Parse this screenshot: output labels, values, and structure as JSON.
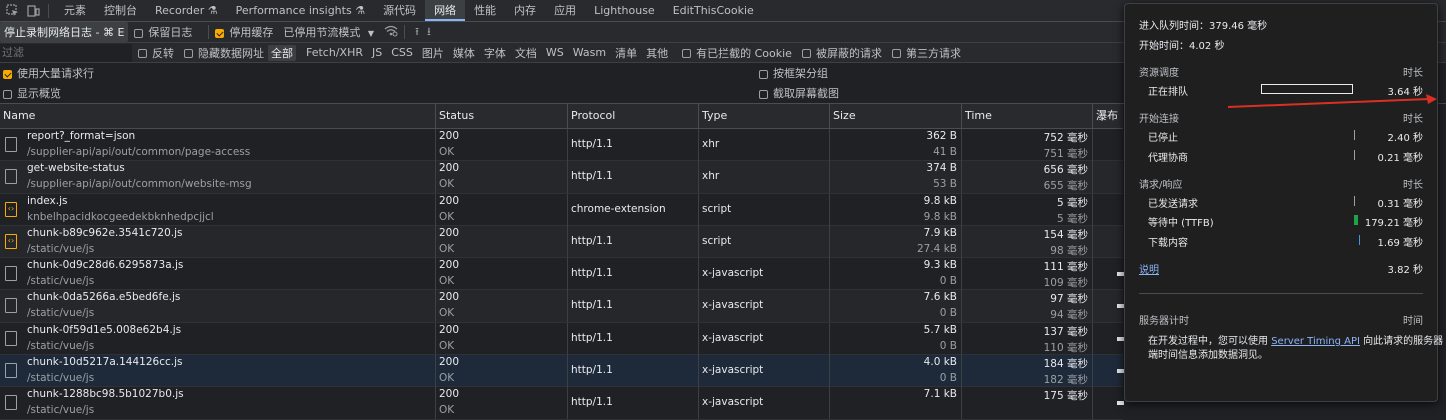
{
  "tabs": [
    "元素",
    "控制台",
    "Recorder",
    "Performance insights",
    "源代码",
    "网络",
    "性能",
    "内存",
    "应用",
    "Lighthouse",
    "EditThisCookie"
  ],
  "toolbar": {
    "stop_tooltip": "停止录制网络日志 - ⌘ E",
    "preserve_log": "保留日志",
    "disable_cache": "停用缓存",
    "throttle": "已停用节流模式"
  },
  "filter_bar": {
    "placeholder": "过滤",
    "invert": "反转",
    "hide_data_urls": "隐藏数据网址",
    "types": [
      "全部",
      "Fetch/XHR",
      "JS",
      "CSS",
      "图片",
      "媒体",
      "字体",
      "文档",
      "WS",
      "Wasm",
      "清单",
      "其他"
    ],
    "blocked_cookies": "有已拦截的 Cookie",
    "blocked_requests": "被屏蔽的请求",
    "third_party": "第三方请求"
  },
  "options": {
    "large_rows": "使用大量请求行",
    "group_by_frame": "按框架分组",
    "show_overview": "显示概览",
    "capture_screenshots": "截取屏幕截图"
  },
  "columns": [
    "Name",
    "Status",
    "Protocol",
    "Type",
    "Size",
    "Time",
    "瀑布"
  ],
  "rows": [
    {
      "name": "report?_format=json",
      "path": "/supplier-api/api/out/common/page-access",
      "status": "200",
      "status_text": "OK",
      "protocol": "http/1.1",
      "type": "xhr",
      "size": "362 B",
      "resource": "41 B",
      "time": "752 毫秒",
      "latency": "751 毫秒",
      "icon": "document-icon"
    },
    {
      "name": "get-website-status",
      "path": "/supplier-api/api/out/common/website-msg",
      "status": "200",
      "status_text": "OK",
      "protocol": "http/1.1",
      "type": "xhr",
      "size": "374 B",
      "resource": "53 B",
      "time": "656 毫秒",
      "latency": "655 毫秒",
      "icon": "document-icon"
    },
    {
      "name": "index.js",
      "path": "knbelhpacidkocgeedekbknhedpcjjcl",
      "status": "200",
      "status_text": "OK",
      "protocol": "chrome-extension",
      "type": "script",
      "size": "9.8 kB",
      "resource": "9.8 kB",
      "time": "5 毫秒",
      "latency": "5 毫秒",
      "icon": "script-icon"
    },
    {
      "name": "chunk-b89c962e.3541c720.js",
      "path": "/static/vue/js",
      "status": "200",
      "status_text": "OK",
      "protocol": "http/1.1",
      "type": "script",
      "size": "7.9 kB",
      "resource": "27.4 kB",
      "time": "154 毫秒",
      "latency": "98 毫秒",
      "icon": "script-icon"
    },
    {
      "name": "chunk-0d9c28d6.6295873a.js",
      "path": "/static/vue/js",
      "status": "200",
      "status_text": "OK",
      "protocol": "http/1.1",
      "type": "x-javascript",
      "size": "9.3 kB",
      "resource": "0 B",
      "time": "111 毫秒",
      "latency": "109 毫秒",
      "icon": "document-icon"
    },
    {
      "name": "chunk-0da5266a.e5bed6fe.js",
      "path": "/static/vue/js",
      "status": "200",
      "status_text": "OK",
      "protocol": "http/1.1",
      "type": "x-javascript",
      "size": "7.6 kB",
      "resource": "0 B",
      "time": "97 毫秒",
      "latency": "94 毫秒",
      "icon": "document-icon"
    },
    {
      "name": "chunk-0f59d1e5.008e62b4.js",
      "path": "/static/vue/js",
      "status": "200",
      "status_text": "OK",
      "protocol": "http/1.1",
      "type": "x-javascript",
      "size": "5.7 kB",
      "resource": "0 B",
      "time": "137 毫秒",
      "latency": "110 毫秒",
      "icon": "document-icon"
    },
    {
      "name": "chunk-10d5217a.144126cc.js",
      "path": "/static/vue/js",
      "status": "200",
      "status_text": "OK",
      "protocol": "http/1.1",
      "type": "x-javascript",
      "size": "4.0 kB",
      "resource": "0 B",
      "time": "184 毫秒",
      "latency": "182 毫秒",
      "icon": "document-icon"
    },
    {
      "name": "chunk-1288bc98.5b1027b0.js",
      "path": "/static/vue/js",
      "status": "200",
      "status_text": "OK",
      "protocol": "http/1.1",
      "type": "x-javascript",
      "size": "7.1 kB",
      "resource": "",
      "time": "175 毫秒",
      "latency": "",
      "icon": "document-icon"
    }
  ],
  "timing": {
    "queued_at": "进入队列时间：379.46 毫秒",
    "started_at": "开始时间：4.02 秒",
    "scheduling_header": "资源调度",
    "duration_label": "时长",
    "queueing_label": "正在排队",
    "queueing_value": "3.64 秒",
    "connection_header": "开始连接",
    "stalled_label": "已停止",
    "stalled_value": "2.40 秒",
    "proxy_label": "代理协商",
    "proxy_value": "0.21 毫秒",
    "request_header": "请求/响应",
    "sent_label": "已发送请求",
    "sent_value": "0.31 毫秒",
    "ttfb_label": "等待中 (TTFB)",
    "ttfb_value": "179.21 毫秒",
    "download_label": "下载内容",
    "download_value": "1.69 毫秒",
    "explanation_link": "说明",
    "total_value": "3.82 秒",
    "server_timing_header": "服务器计时",
    "time_label": "时间",
    "server_timing_text_1": "在开发过程中，您可以使用",
    "server_timing_link": "Server Timing API",
    "server_timing_text_2": "向此请求的服务器",
    "server_timing_text_3": "端时间信息添加数据洞见。"
  },
  "colors": {
    "accent": "#8ab4f8",
    "checkbox": "#f9ab00",
    "ttfb": "#1ea446",
    "annotation": "#d93025"
  }
}
